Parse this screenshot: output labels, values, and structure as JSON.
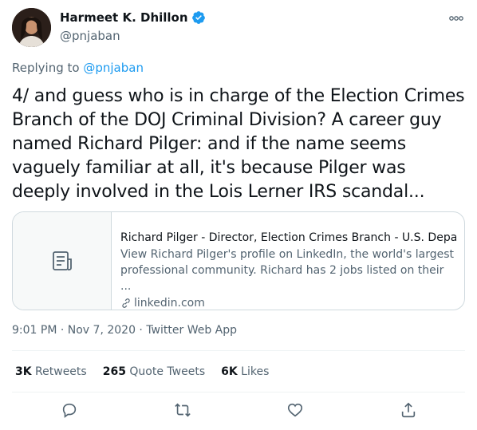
{
  "user": {
    "display_name": "Harmeet K. Dhillon",
    "handle": "@pnjaban"
  },
  "reply": {
    "prefix": "Replying to",
    "handle": "@pnjaban"
  },
  "tweet": {
    "text": "4/ and guess who is in charge of the Election Crimes Branch of the DOJ Criminal Division? A career guy named Richard Pilger: and if the name seems vaguely familiar at all, it's because Pilger was deeply involved in the Lois Lerner IRS scandal..."
  },
  "card": {
    "title": "Richard Pilger - Director, Election Crimes Branch - U.S. Depart...",
    "description": "View Richard Pilger's profile on LinkedIn, the world's largest professional community. Richard has 2 jobs listed on their ...",
    "domain": "linkedin.com"
  },
  "meta": {
    "timestamp": "9:01 PM · Nov 7, 2020 · Twitter Web App"
  },
  "stats": {
    "retweets_count": "3K",
    "retweets_label": "Retweets",
    "quotes_count": "265",
    "quotes_label": "Quote Tweets",
    "likes_count": "6K",
    "likes_label": "Likes"
  },
  "colors": {
    "accent": "#1d9bf0",
    "text": "#0f1419",
    "secondary": "#536471",
    "border": "#cfd9de"
  }
}
